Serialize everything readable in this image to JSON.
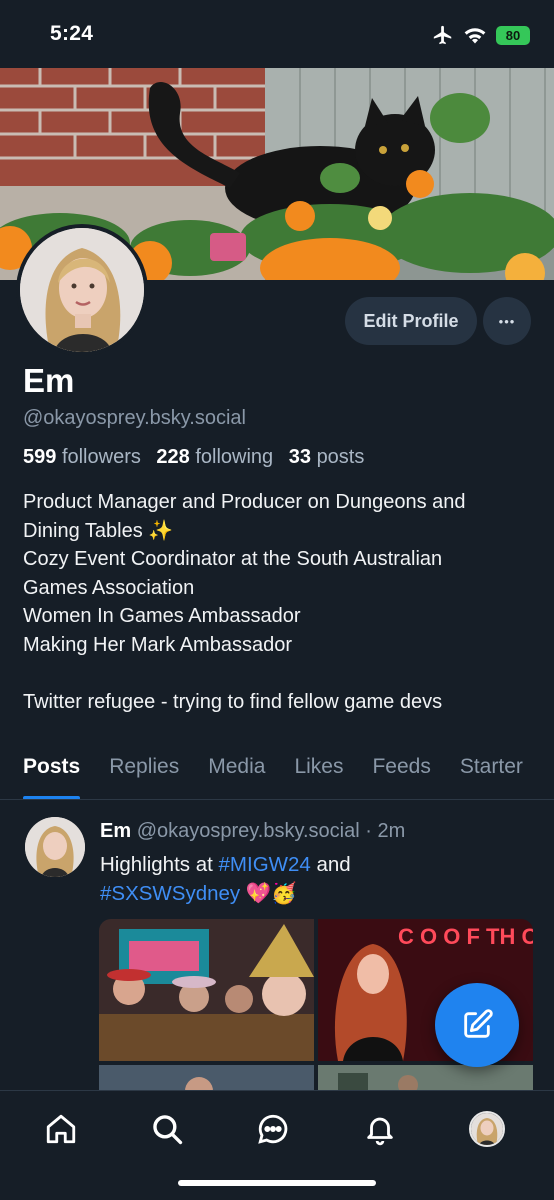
{
  "status_bar": {
    "time": "5:24",
    "battery": "80",
    "icons": [
      "airplane-icon",
      "wifi-icon",
      "battery-icon"
    ]
  },
  "profile": {
    "name": "Em",
    "handle": "@okayosprey.bsky.social",
    "followers_count": "599",
    "followers_label": "followers",
    "following_count": "228",
    "following_label": "following",
    "posts_count": "33",
    "posts_label": "posts",
    "edit_label": "Edit Profile",
    "more_label": "•••",
    "bio_lines": [
      "Product Manager and Producer on Dungeons and",
      "Dining Tables ✨",
      "Cozy Event Coordinator at the South Australian",
      "Games Association",
      "Women In Games Ambassador",
      "Making Her Mark Ambassador",
      "",
      "Twitter refugee - trying to find fellow game devs"
    ]
  },
  "tabs": [
    "Posts",
    "Replies",
    "Media",
    "Likes",
    "Feeds",
    "Starter"
  ],
  "active_tab": "Posts",
  "post": {
    "author": "Em",
    "handle": "@okayosprey.bsky.social",
    "separator": "·",
    "time": "2m",
    "text_prefix": "Highlights at ",
    "hashtag1": "#MIGW24",
    "text_mid": " and",
    "hashtag2": "#SXSWSydney",
    "emoji": " 💖🥳"
  },
  "bottom_nav": [
    "home-icon",
    "search-icon",
    "chat-icon",
    "bell-icon",
    "profile-avatar"
  ],
  "colors": {
    "background": "#161e27",
    "accent": "#1d83f0",
    "muted": "#8a98a8",
    "button_bg": "#263342"
  }
}
